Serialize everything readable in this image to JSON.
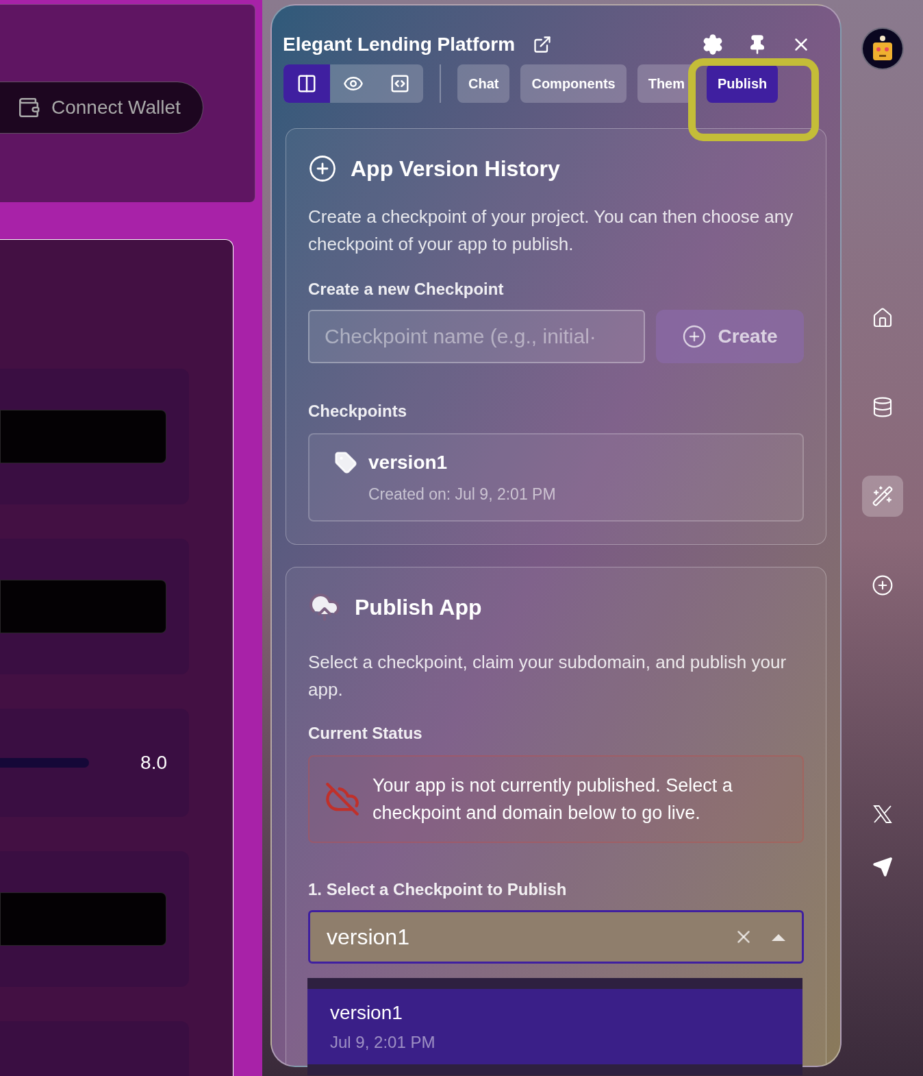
{
  "left_app": {
    "connect_button": "Connect Wallet",
    "slider_reading": "8.0"
  },
  "panel": {
    "title": "Elegant Lending Platform",
    "view_modes": [
      {
        "kind": "split",
        "selected": true
      },
      {
        "kind": "preview",
        "selected": false
      },
      {
        "kind": "code",
        "selected": false
      }
    ],
    "tabs": [
      {
        "label": "Chat",
        "selected": false
      },
      {
        "label": "Components",
        "selected": false
      },
      {
        "label": "Them",
        "selected": false
      },
      {
        "label": "Publish",
        "selected": true
      }
    ],
    "version_history": {
      "title": "App Version History",
      "description": "Create a checkpoint of your project. You can then choose any checkpoint of your app to publish.",
      "new_label": "Create a new Checkpoint",
      "name_field": {
        "placeholder": "Checkpoint name (e.g., initial·"
      },
      "create_button": "Create",
      "checkpoints_label": "Checkpoints",
      "checkpoints": [
        {
          "name": "version1",
          "created": "Created on: Jul 9, 2:01 PM"
        }
      ]
    },
    "publish": {
      "title": "Publish App",
      "description": "Select a checkpoint, claim your subdomain, and publish your app.",
      "status_label": "Current Status",
      "status_message": "Your app is not currently published. Select a checkpoint and domain below to go live.",
      "select_label": "1. Select a Checkpoint to Publish",
      "select_value": "version1",
      "options": [
        {
          "name": "version1",
          "date": "Jul 9, 2:01 PM",
          "selected": true
        }
      ]
    }
  },
  "sidebar": {
    "items": [
      {
        "kind": "home",
        "selected": false
      },
      {
        "kind": "database",
        "selected": false
      },
      {
        "kind": "wand",
        "selected": true
      },
      {
        "kind": "add",
        "selected": false
      }
    ]
  }
}
